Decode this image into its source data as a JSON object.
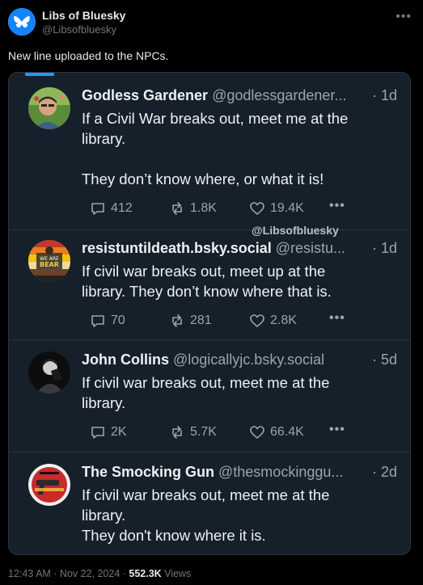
{
  "post": {
    "author_name": "Libs of Bluesky",
    "author_handle": "@Libsofbluesky",
    "text": "New line uploaded to the NPCs.",
    "more_icon": "more-horizontal-icon",
    "timestamp": "12:43 AM · Nov 22, 2024 · ",
    "views_count": "552.3K",
    "views_label": " Views",
    "watermark": "@Libsofbluesky"
  },
  "embedded": {
    "accent_color": "#1d9bf0",
    "items": [
      {
        "name": "Godless Gardener",
        "handle": " @godlessgardener...",
        "time": "· 1d",
        "text_lines": [
          "If a Civil War breaks out, meet me at the",
          "library.",
          "",
          "They don’t know where, or what it is!"
        ],
        "replies": "412",
        "reposts": "1.8K",
        "likes": "19.4K"
      },
      {
        "name": "resistuntildeath.bsky.social",
        "handle": " @resistu...",
        "time": "· 1d",
        "avatar_text_1": "WE ARE",
        "avatar_text_2": "BEAR",
        "text_lines": [
          "If civil war breaks out, meet up at the",
          "library. They don’t know where that is."
        ],
        "replies": "70",
        "reposts": "281",
        "likes": "2.8K"
      },
      {
        "name": "John Collins",
        "handle": " @logicallyjc.bsky.social",
        "time": "· 5d",
        "text_lines": [
          "If civil war breaks out, meet me at the",
          "library."
        ],
        "replies": "2K",
        "reposts": "5.7K",
        "likes": "66.4K"
      },
      {
        "name": "The Smocking Gun",
        "handle": " @thesmockinggu...",
        "time": "· 2d",
        "text_lines": [
          "If civil war breaks out, meet me at the",
          "library.",
          "They don't know where it is."
        ]
      }
    ]
  }
}
